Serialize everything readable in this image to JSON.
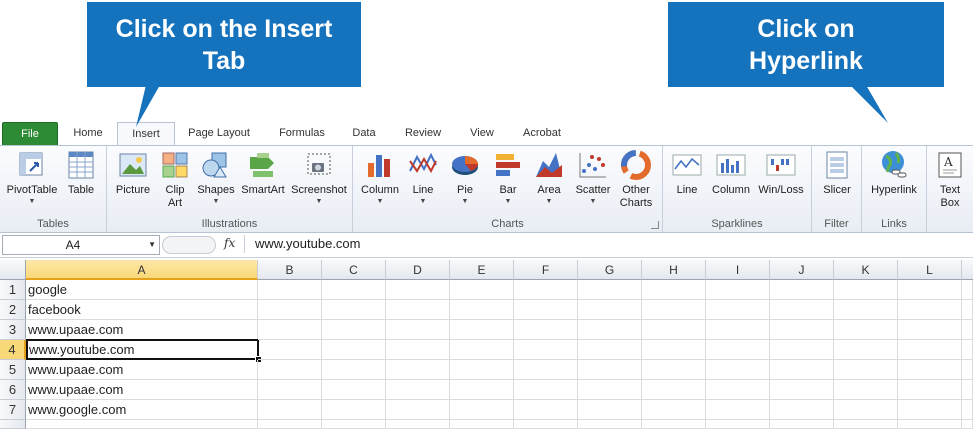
{
  "callouts": {
    "insert": {
      "line1": "Click on the Insert",
      "line2": "Tab"
    },
    "hyperlink": {
      "line1": "Click on",
      "line2": "Hyperlink"
    }
  },
  "tabs": [
    "File",
    "Home",
    "Insert",
    "Page Layout",
    "Formulas",
    "Data",
    "Review",
    "View",
    "Acrobat"
  ],
  "active_tab": "Insert",
  "ribbon": {
    "tables": {
      "label": "Tables",
      "pivot": "PivotTable",
      "table": "Table"
    },
    "illustrations": {
      "label": "Illustrations",
      "picture": "Picture",
      "clip1": "Clip",
      "clip2": "Art",
      "shapes": "Shapes",
      "smartart": "SmartArt",
      "screenshot": "Screenshot"
    },
    "charts": {
      "label": "Charts",
      "column": "Column",
      "line": "Line",
      "pie": "Pie",
      "bar": "Bar",
      "area": "Area",
      "scatter": "Scatter",
      "other1": "Other",
      "other2": "Charts"
    },
    "sparklines": {
      "label": "Sparklines",
      "line": "Line",
      "column": "Column",
      "winloss": "Win/Loss"
    },
    "filter": {
      "label": "Filter",
      "slicer": "Slicer"
    },
    "links": {
      "label": "Links",
      "hyperlink": "Hyperlink"
    },
    "text": {
      "textbox1": "Text",
      "textbox2": "Box"
    }
  },
  "formula_bar": {
    "name_box": "A4",
    "fx": "fx",
    "value": "www.youtube.com"
  },
  "sheet": {
    "columns": [
      "A",
      "B",
      "C",
      "D",
      "E",
      "F",
      "G",
      "H",
      "I",
      "J",
      "K",
      "L"
    ],
    "rows": [
      "1",
      "2",
      "3",
      "4",
      "5",
      "6",
      "7"
    ],
    "cells_a": [
      "google",
      "facebook",
      "www.upaae.com",
      "www.youtube.com",
      "www.upaae.com",
      "www.upaae.com",
      "www.google.com"
    ],
    "active_cell": "A4"
  },
  "colors": {
    "callout": "#1572bd",
    "file_tab": "#2e8b35",
    "selection": "#f9d879"
  }
}
